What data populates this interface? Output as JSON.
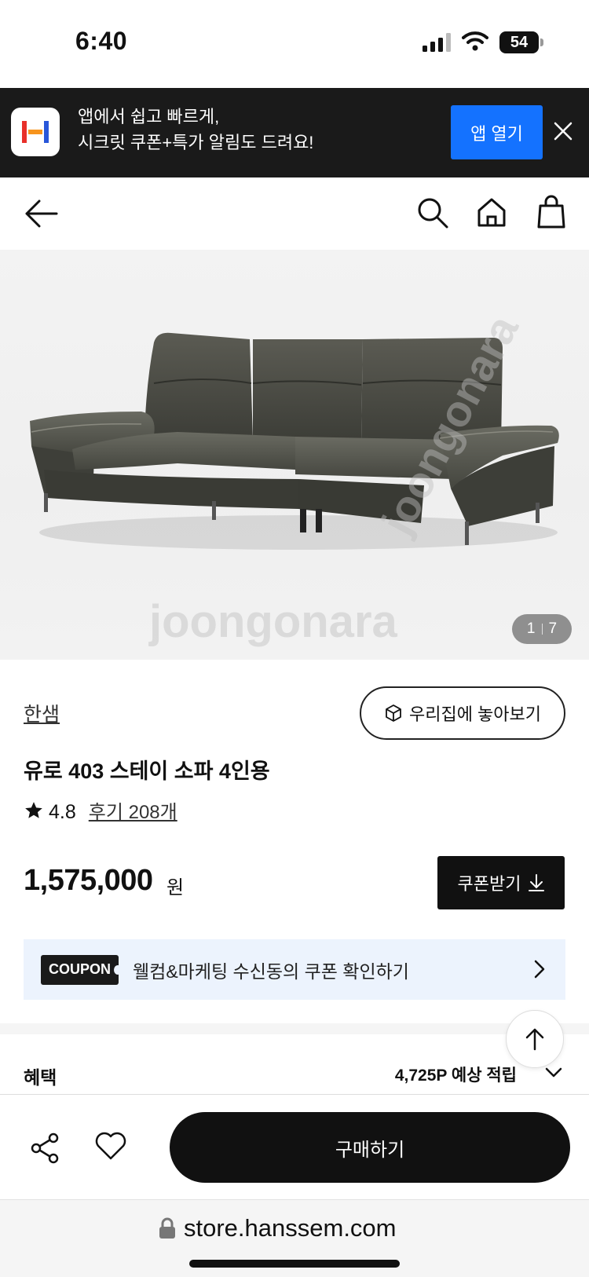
{
  "status_bar": {
    "time": "6:40",
    "battery": "54"
  },
  "app_banner": {
    "line1": "앱에서 쉽고 빠르게,",
    "line2": "시크릿 쿠폰+특가 알림도 드려요!",
    "open_label": "앱 열기"
  },
  "product": {
    "image_counter": {
      "current": "1",
      "total": "7"
    },
    "brand": "한샘",
    "ar_label": "우리집에 놓아보기",
    "title": "유로 403 스테이 소파 4인용",
    "rating": "4.8",
    "reviews": "후기 208개",
    "price": "1,575,000",
    "price_unit": "원",
    "coupon_button": "쿠폰받기"
  },
  "coupon_banner": {
    "tag": "COUPON",
    "text": "웰컴&마케팅 수신동의 쿠폰 확인하기"
  },
  "benefit": {
    "label": "혜택",
    "points": "4,725P 예상 적립"
  },
  "action_bar": {
    "buy_label": "구매하기"
  },
  "browser": {
    "url": "store.hanssem.com"
  },
  "watermark": "joongonara",
  "colors": {
    "accent_blue": "#1472ff",
    "dark": "#111111",
    "coupon_bg": "#ecf3fd"
  }
}
